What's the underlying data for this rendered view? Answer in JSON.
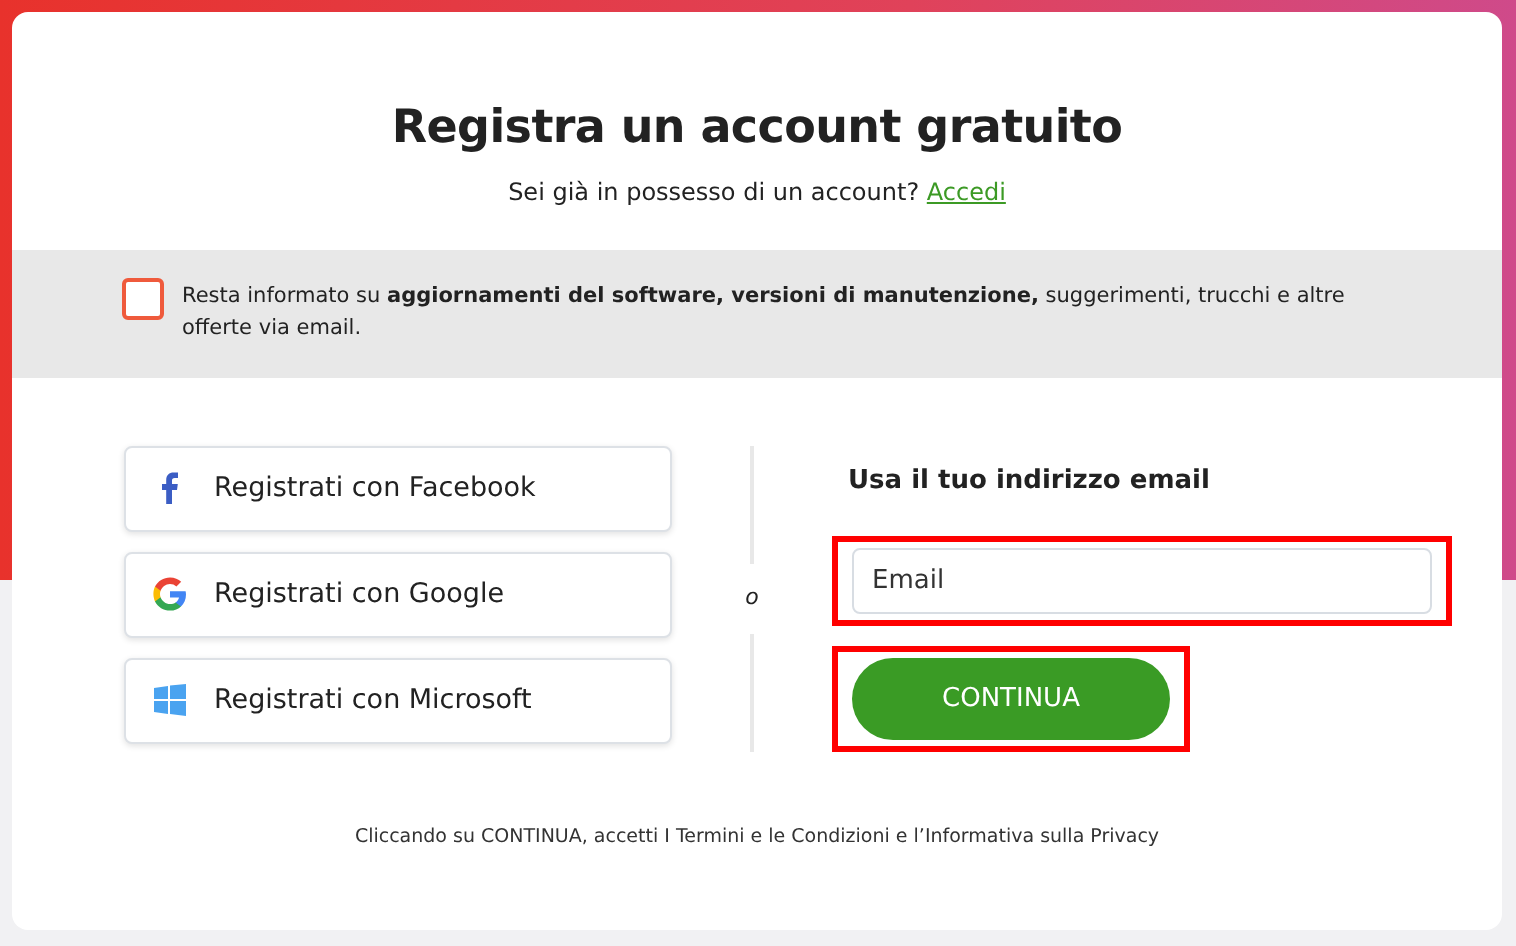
{
  "title": "Registra un account gratuito",
  "login_prompt": {
    "text": "Sei già in possesso di un account?",
    "link": "Accedi"
  },
  "newsletter": {
    "checked": false,
    "text": "Resta informato su **aggiornamenti del software, versioni di manutenzione,** suggerimenti, trucchi e altre offerte via email."
  },
  "social_buttons": [
    {
      "kind": "facebook",
      "label": "Registrati con Facebook"
    },
    {
      "kind": "google",
      "label": "Registrati con Google"
    },
    {
      "kind": "microsoft",
      "label": "Registrati con Microsoft"
    }
  ],
  "separator": "o",
  "email_section": {
    "heading": "Usa il tuo indirizzo email",
    "placeholder": "Email",
    "field_highlighted": true,
    "button": "CONTINUA",
    "button_highlighted": true
  },
  "terms": "Cliccando su CONTINUA, accetti I Termini e le Condizioni e l’Informativa sulla Privacy"
}
